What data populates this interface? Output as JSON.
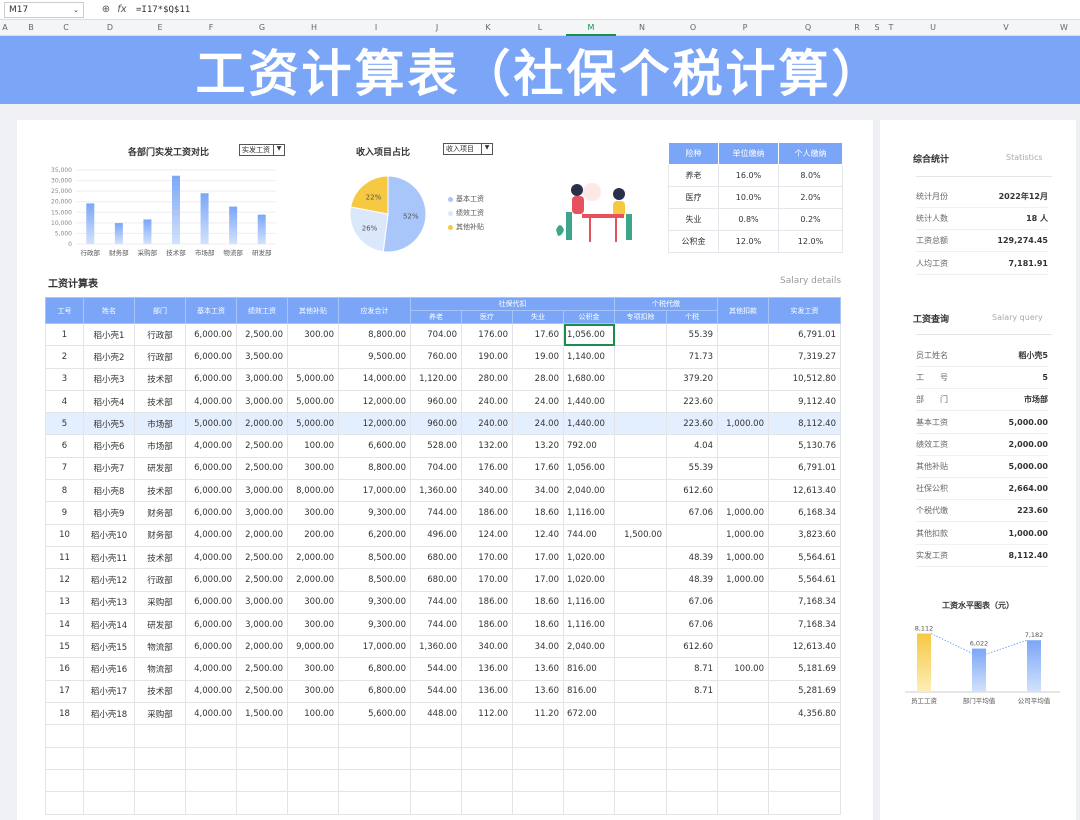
{
  "formula_bar": {
    "cell": "M17",
    "fx_icon": "fx",
    "formula": "=I17*$Q$11"
  },
  "columns": [
    "A",
    "B",
    "C",
    "D",
    "E",
    "F",
    "G",
    "H",
    "I",
    "J",
    "K",
    "L",
    "M",
    "N",
    "O",
    "P",
    "Q",
    "R",
    "S",
    "T",
    "U",
    "V",
    "W"
  ],
  "title": "工资计算表（社保个税计算）",
  "bar_panel": {
    "title": "各部门实发工资对比",
    "dropdown": "实发工资"
  },
  "pie_panel": {
    "title": "收入项目占比",
    "dropdown": "收入项目"
  },
  "rate_table": {
    "headers": [
      "险种",
      "单位缴纳",
      "个人缴纳"
    ],
    "rows": [
      [
        "养老",
        "16.0%",
        "8.0%"
      ],
      [
        "医疗",
        "10.0%",
        "2.0%"
      ],
      [
        "失业",
        "0.8%",
        "0.2%"
      ],
      [
        "公积金",
        "12.0%",
        "12.0%"
      ]
    ]
  },
  "chart_data": [
    {
      "type": "bar",
      "title": "各部门实发工资对比",
      "categories": [
        "行政部",
        "财务部",
        "采购部",
        "技术部",
        "市场部",
        "物流部",
        "研发部"
      ],
      "values": [
        19200,
        9900,
        11600,
        32300,
        24000,
        17700,
        13900
      ],
      "ylim": [
        0,
        35000
      ],
      "yticks": [
        "35,000",
        "30,000",
        "25,000",
        "20,000",
        "15,000",
        "10,000",
        "5,000",
        "0"
      ],
      "color": "#7ba6f7"
    },
    {
      "type": "pie",
      "title": "收入项目占比",
      "labels": [
        "基本工资",
        "绩效工资",
        "其他补贴"
      ],
      "values": [
        52,
        26,
        22
      ],
      "value_labels": [
        "52%",
        "26%",
        "22%"
      ],
      "colors": [
        "#a8c6fa",
        "#dbe7fb",
        "#f7c842"
      ]
    },
    {
      "type": "bar",
      "title": "工资水平图表（元）",
      "categories": [
        "员工工资",
        "部门平均值",
        "公司平均值"
      ],
      "values": [
        8112,
        6022,
        7182
      ],
      "value_labels": [
        "8,112",
        "6,022",
        "7,182"
      ],
      "colors": [
        "#f7c842",
        "#7ba6f7",
        "#7ba6f7"
      ]
    }
  ],
  "salary": {
    "title": "工资计算表",
    "subtitle": "Salary details",
    "header_top": {
      "id": "工号",
      "name": "姓名",
      "dept": "部门",
      "base": "基本工资",
      "perf": "绩效工资",
      "other": "其他补贴",
      "gross": "应发合计",
      "social": "社保代扣",
      "tax": "个税代缴",
      "deduct": "其他扣款",
      "net": "实发工资"
    },
    "header_sub": {
      "pension": "养老",
      "medical": "医疗",
      "unemp": "失业",
      "fund": "公积金",
      "special": "专项扣除",
      "itax": "个税"
    },
    "rows": [
      [
        "1",
        "稻小壳1",
        "行政部",
        "6,000.00",
        "2,500.00",
        "300.00",
        "8,800.00",
        "704.00",
        "176.00",
        "17.60",
        "1,056.00",
        "",
        "55.39",
        "",
        "6,791.01"
      ],
      [
        "2",
        "稻小壳2",
        "行政部",
        "6,000.00",
        "3,500.00",
        "",
        "9,500.00",
        "760.00",
        "190.00",
        "19.00",
        "1,140.00",
        "",
        "71.73",
        "",
        "7,319.27"
      ],
      [
        "3",
        "稻小壳3",
        "技术部",
        "6,000.00",
        "3,000.00",
        "5,000.00",
        "14,000.00",
        "1,120.00",
        "280.00",
        "28.00",
        "1,680.00",
        "",
        "379.20",
        "",
        "10,512.80"
      ],
      [
        "4",
        "稻小壳4",
        "技术部",
        "4,000.00",
        "3,000.00",
        "5,000.00",
        "12,000.00",
        "960.00",
        "240.00",
        "24.00",
        "1,440.00",
        "",
        "223.60",
        "",
        "9,112.40"
      ],
      [
        "5",
        "稻小壳5",
        "市场部",
        "5,000.00",
        "2,000.00",
        "5,000.00",
        "12,000.00",
        "960.00",
        "240.00",
        "24.00",
        "1,440.00",
        "",
        "223.60",
        "1,000.00",
        "8,112.40"
      ],
      [
        "6",
        "稻小壳6",
        "市场部",
        "4,000.00",
        "2,500.00",
        "100.00",
        "6,600.00",
        "528.00",
        "132.00",
        "13.20",
        "792.00",
        "",
        "4.04",
        "",
        "5,130.76"
      ],
      [
        "7",
        "稻小壳7",
        "研发部",
        "6,000.00",
        "2,500.00",
        "300.00",
        "8,800.00",
        "704.00",
        "176.00",
        "17.60",
        "1,056.00",
        "",
        "55.39",
        "",
        "6,791.01"
      ],
      [
        "8",
        "稻小壳8",
        "技术部",
        "6,000.00",
        "3,000.00",
        "8,000.00",
        "17,000.00",
        "1,360.00",
        "340.00",
        "34.00",
        "2,040.00",
        "",
        "612.60",
        "",
        "12,613.40"
      ],
      [
        "9",
        "稻小壳9",
        "财务部",
        "6,000.00",
        "3,000.00",
        "300.00",
        "9,300.00",
        "744.00",
        "186.00",
        "18.60",
        "1,116.00",
        "",
        "67.06",
        "1,000.00",
        "6,168.34"
      ],
      [
        "10",
        "稻小壳10",
        "财务部",
        "4,000.00",
        "2,000.00",
        "200.00",
        "6,200.00",
        "496.00",
        "124.00",
        "12.40",
        "744.00",
        "1,500.00",
        "",
        "1,000.00",
        "3,823.60"
      ],
      [
        "11",
        "稻小壳11",
        "技术部",
        "4,000.00",
        "2,500.00",
        "2,000.00",
        "8,500.00",
        "680.00",
        "170.00",
        "17.00",
        "1,020.00",
        "",
        "48.39",
        "1,000.00",
        "5,564.61"
      ],
      [
        "12",
        "稻小壳12",
        "行政部",
        "6,000.00",
        "2,500.00",
        "2,000.00",
        "8,500.00",
        "680.00",
        "170.00",
        "17.00",
        "1,020.00",
        "",
        "48.39",
        "1,000.00",
        "5,564.61"
      ],
      [
        "13",
        "稻小壳13",
        "采购部",
        "6,000.00",
        "3,000.00",
        "300.00",
        "9,300.00",
        "744.00",
        "186.00",
        "18.60",
        "1,116.00",
        "",
        "67.06",
        "",
        "7,168.34"
      ],
      [
        "14",
        "稻小壳14",
        "研发部",
        "6,000.00",
        "3,000.00",
        "300.00",
        "9,300.00",
        "744.00",
        "186.00",
        "18.60",
        "1,116.00",
        "",
        "67.06",
        "",
        "7,168.34"
      ],
      [
        "15",
        "稻小壳15",
        "物流部",
        "6,000.00",
        "2,000.00",
        "9,000.00",
        "17,000.00",
        "1,360.00",
        "340.00",
        "34.00",
        "2,040.00",
        "",
        "612.60",
        "",
        "12,613.40"
      ],
      [
        "16",
        "稻小壳16",
        "物流部",
        "4,000.00",
        "2,500.00",
        "300.00",
        "6,800.00",
        "544.00",
        "136.00",
        "13.60",
        "816.00",
        "",
        "8.71",
        "100.00",
        "5,181.69"
      ],
      [
        "17",
        "稻小壳17",
        "技术部",
        "4,000.00",
        "2,500.00",
        "300.00",
        "6,800.00",
        "544.00",
        "136.00",
        "13.60",
        "816.00",
        "",
        "8.71",
        "",
        "5,281.69"
      ],
      [
        "18",
        "稻小壳18",
        "采购部",
        "4,000.00",
        "1,500.00",
        "100.00",
        "5,600.00",
        "448.00",
        "112.00",
        "11.20",
        "672.00",
        "",
        "",
        "",
        "4,356.80"
      ]
    ]
  },
  "summary": {
    "title": "综合统计",
    "subtitle": "Statistics",
    "rows": [
      [
        "统计月份",
        "2022年12月"
      ],
      [
        "统计人数",
        "18 人"
      ],
      [
        "工资总额",
        "129,274.45"
      ],
      [
        "人均工资",
        "7,181.91"
      ]
    ]
  },
  "query": {
    "title": "工资查询",
    "subtitle": "Salary query",
    "rows": [
      [
        "员工姓名",
        "稻小壳5"
      ],
      [
        "工　　号",
        "5"
      ],
      [
        "部　　门",
        "市场部"
      ],
      [
        "基本工资",
        "5,000.00"
      ],
      [
        "绩效工资",
        "2,000.00"
      ],
      [
        "其他补贴",
        "5,000.00"
      ],
      [
        "社保公积",
        "2,664.00"
      ],
      [
        "个税代缴",
        "223.60"
      ],
      [
        "其他扣款",
        "1,000.00"
      ],
      [
        "实发工资",
        "8,112.40"
      ]
    ]
  },
  "level_chart": {
    "title": "工资水平图表（元）"
  }
}
